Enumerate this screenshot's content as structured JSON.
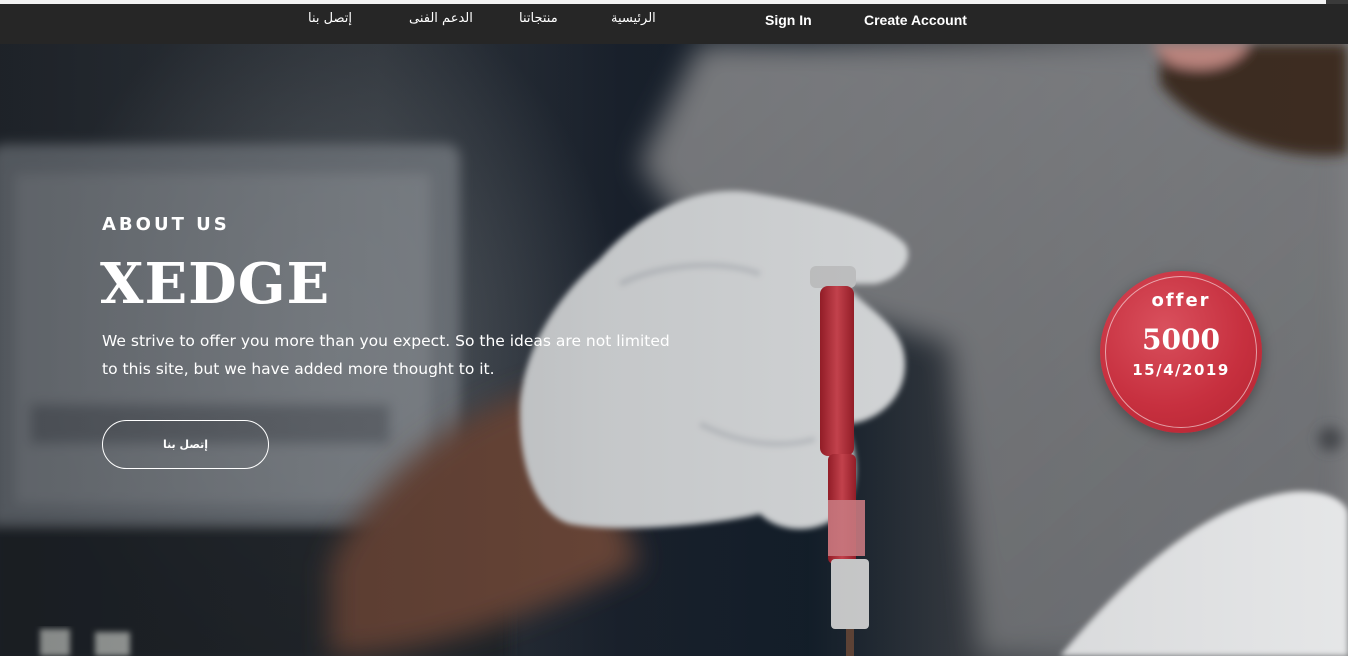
{
  "nav": {
    "contact": "إتصل بنا",
    "support": "الدعم الفنى",
    "products": "منتجاتنا",
    "home": "الرئيسية",
    "sign_in": "Sign In",
    "create_account": "Create Account"
  },
  "hero": {
    "eyebrow": "ABOUT US",
    "title": "XEDGE",
    "tagline": "We strive to offer you more than you expect. So the ideas are not limited to this site, but we have added more thought to it.",
    "cta_label": "إتصل بنا"
  },
  "offer": {
    "label": "offer",
    "amount": "5000",
    "date": "15/4/2019"
  },
  "colors": {
    "navbar": "#262626",
    "badge": "#c7303f",
    "text": "#ffffff"
  }
}
